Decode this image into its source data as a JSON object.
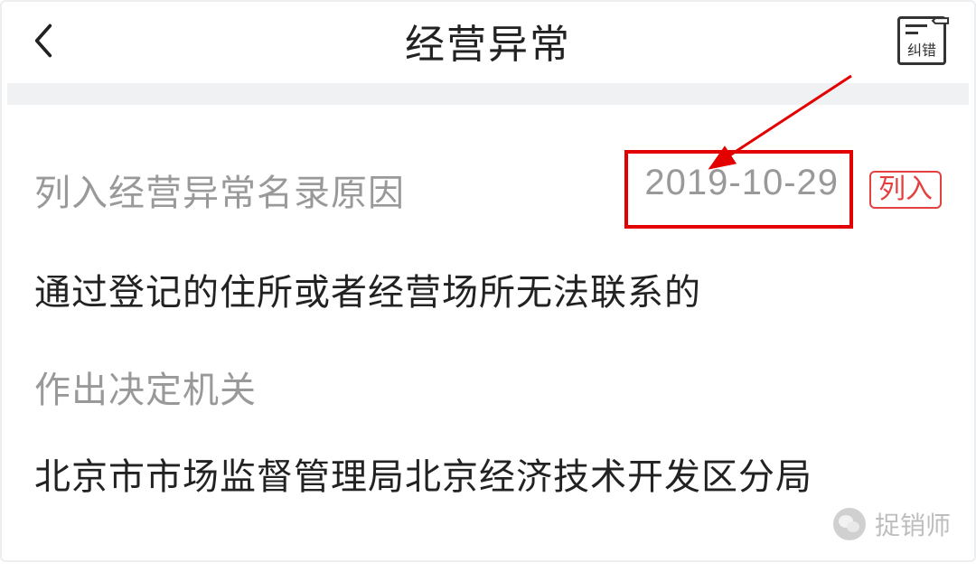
{
  "header": {
    "title": "经营异常",
    "correctLabel": "纠错"
  },
  "reason": {
    "label": "列入经营异常名录原因",
    "date": "2019-10-29",
    "statusTag": "列入",
    "value": "通过登记的住所或者经营场所无法联系的"
  },
  "authority": {
    "label": "作出决定机关",
    "value": "北京市市场监督管理局北京经济技术开发区分局"
  },
  "watermark": {
    "text": "捉销师"
  }
}
